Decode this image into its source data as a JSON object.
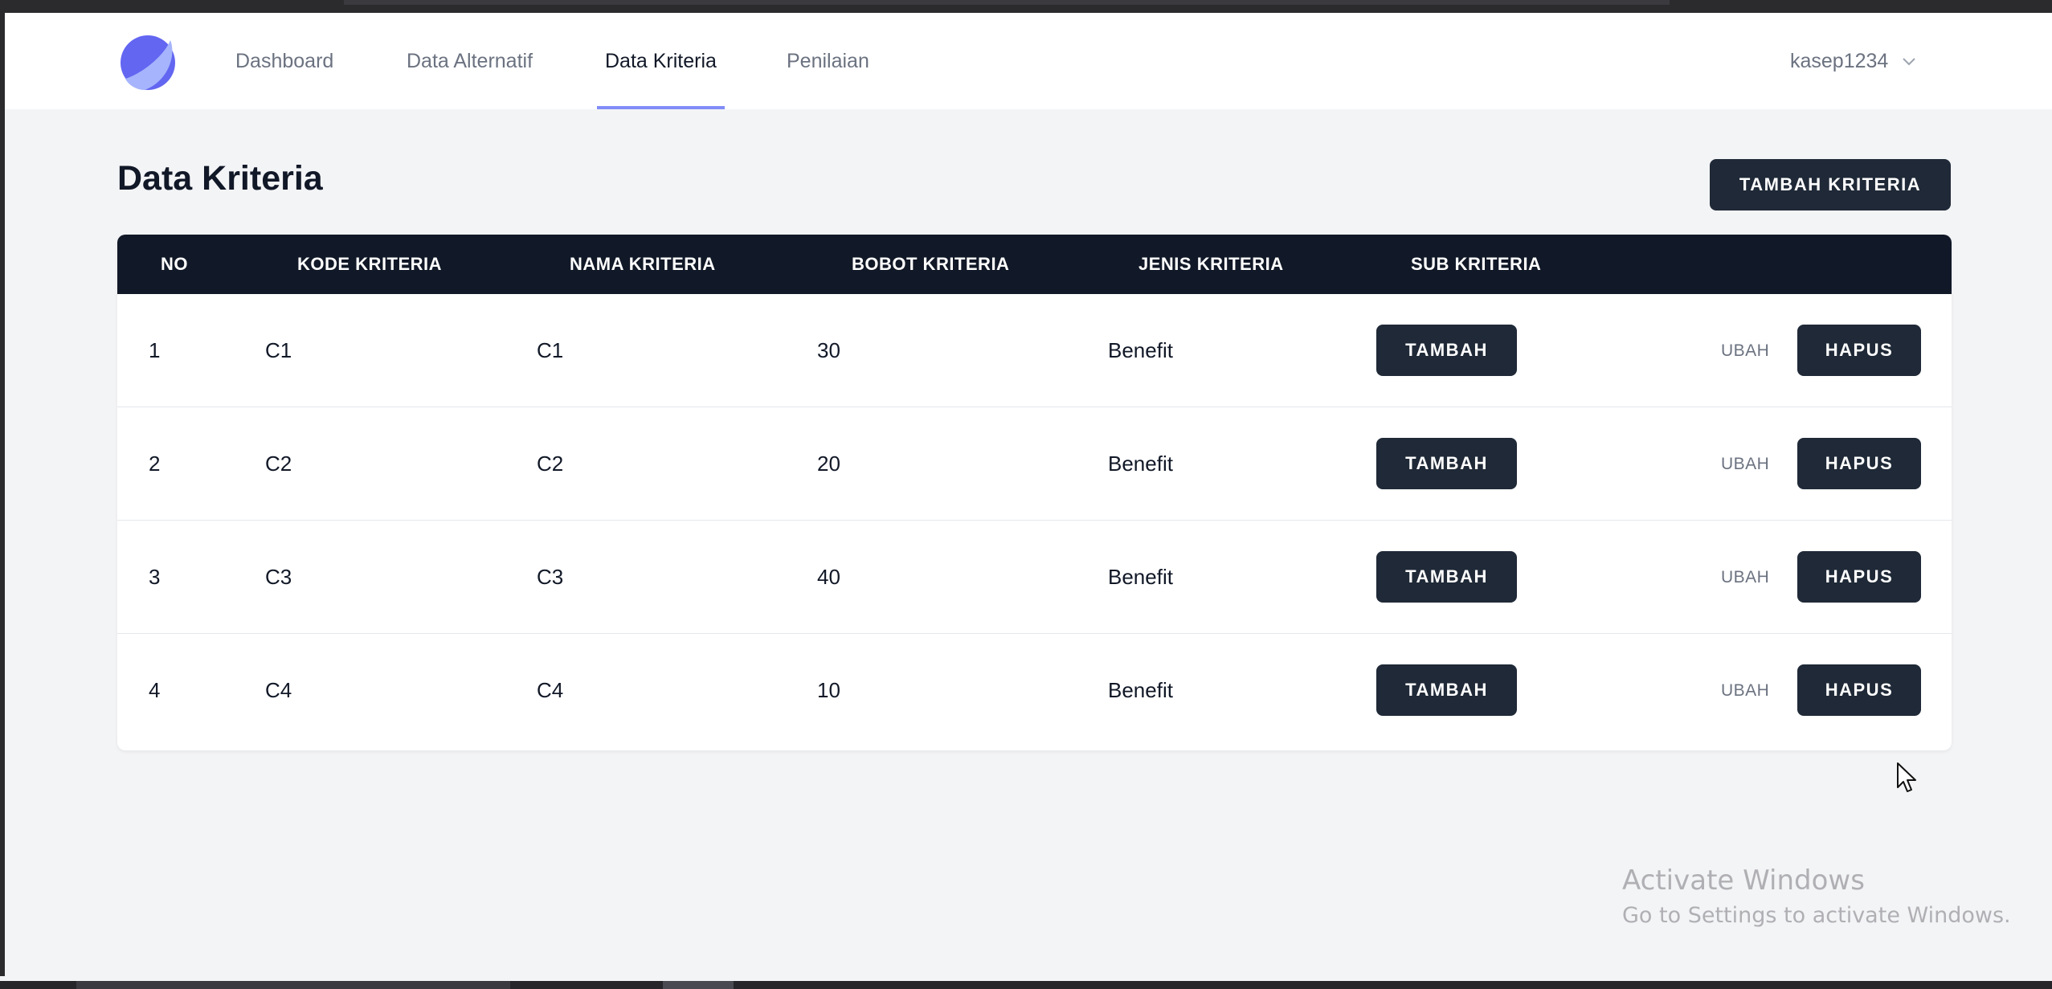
{
  "nav": {
    "items": [
      {
        "label": "Dashboard",
        "active": false
      },
      {
        "label": "Data Alternatif",
        "active": false
      },
      {
        "label": "Data Kriteria",
        "active": true
      },
      {
        "label": "Penilaian",
        "active": false
      }
    ],
    "user": "kasep1234",
    "logo_icon": "logo-icon",
    "accent_color": "#818cf8"
  },
  "page": {
    "title": "Data Kriteria",
    "add_button": "TAMBAH KRITERIA"
  },
  "table": {
    "headers": [
      "NO",
      "KODE KRITERIA",
      "NAMA KRITERIA",
      "BOBOT KRITERIA",
      "JENIS KRITERIA",
      "SUB KRITERIA"
    ],
    "rows": [
      {
        "no": "1",
        "kode": "C1",
        "nama": "C1",
        "bobot": "30",
        "jenis": "Benefit"
      },
      {
        "no": "2",
        "kode": "C2",
        "nama": "C2",
        "bobot": "20",
        "jenis": "Benefit"
      },
      {
        "no": "3",
        "kode": "C3",
        "nama": "C3",
        "bobot": "40",
        "jenis": "Benefit"
      },
      {
        "no": "4",
        "kode": "C4",
        "nama": "C4",
        "bobot": "10",
        "jenis": "Benefit"
      }
    ],
    "sub_button": "TAMBAH",
    "edit_label": "UBAH",
    "delete_button": "HAPUS"
  },
  "watermark": {
    "line1": "Activate Windows",
    "line2": "Go to Settings to activate Windows."
  }
}
